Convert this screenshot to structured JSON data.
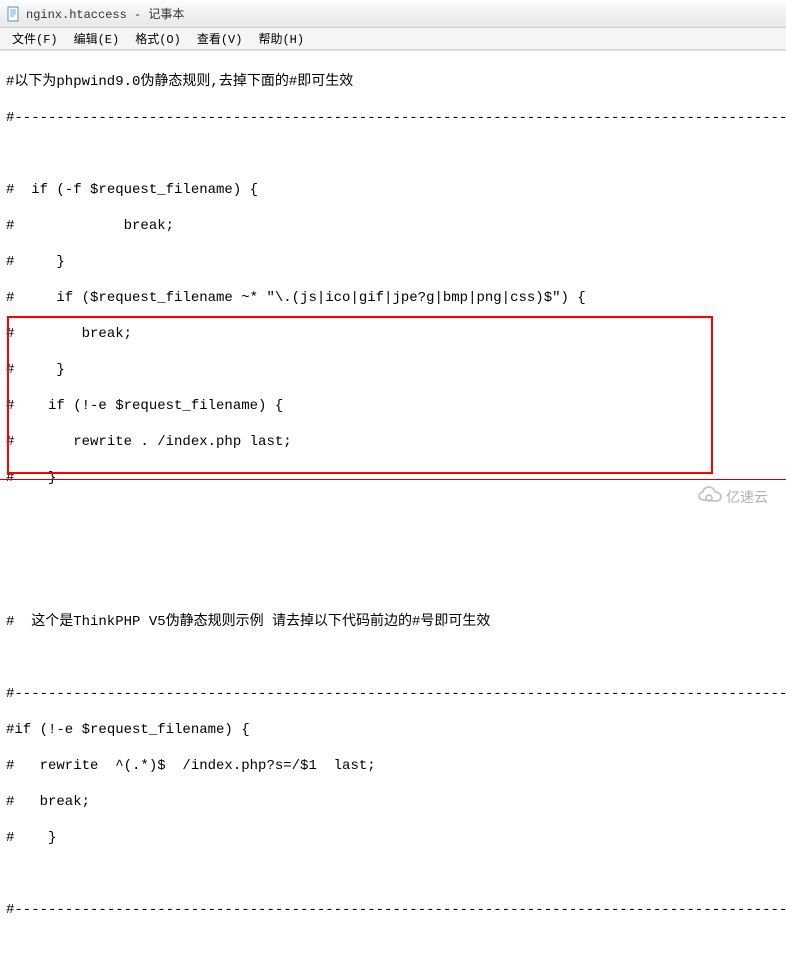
{
  "window": {
    "title": "nginx.htaccess - 记事本"
  },
  "menu": {
    "file": "文件(F)",
    "edit": "编辑(E)",
    "format": "格式(O)",
    "view": "查看(V)",
    "help": "帮助(H)"
  },
  "content": {
    "line1": "#以下为phpwind9.0伪静态规则,去掉下面的#即可生效",
    "line2": "#---------------------------------------------------------------------------------------------",
    "line3": "",
    "line4": "#  if (-f $request_filename) {",
    "line5": "#             break;",
    "line6": "#     }",
    "line7": "#     if ($request_filename ~* \"\\.(js|ico|gif|jpe?g|bmp|png|css)$\") {",
    "line8": "#        break;",
    "line9": "#     }",
    "line10": "#    if (!-e $request_filename) {",
    "line11": "#       rewrite . /index.php last;",
    "line12": "#    }",
    "line13": "",
    "line14": "",
    "line15": "",
    "line16": "#  这个是ThinkPHP V5伪静态规则示例 请去掉以下代码前边的#号即可生效",
    "line17": "",
    "line18": "#---------------------------------------------------------------------------------------------",
    "line19": "#if (!-e $request_filename) {",
    "line20": "#   rewrite  ^(.*)$  /index.php?s=/$1  last;",
    "line21": "#   break;",
    "line22": "#    }",
    "line23": "",
    "line24": "#---------------------------------------------------------------------------------------------"
  },
  "watermark": {
    "text": "亿速云"
  }
}
